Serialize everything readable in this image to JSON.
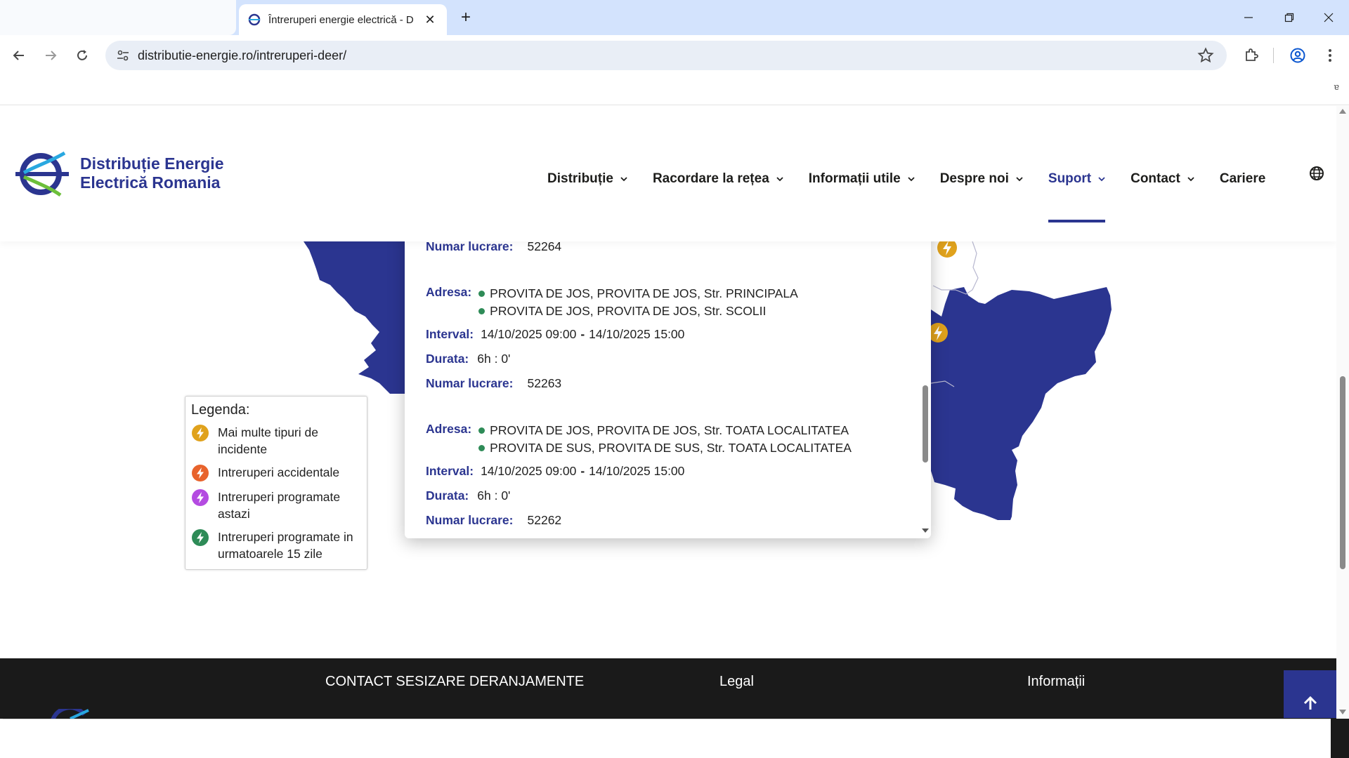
{
  "browser": {
    "tab_title": "Întreruperi energie electrică - D",
    "url": "distributie-energie.ro/intreruperi-deer/",
    "strip_glyph": "ɐ"
  },
  "site": {
    "logo_line1": "Distribuție Energie",
    "logo_line2": "Electrică Romania",
    "nav": [
      {
        "label": "Distribuție",
        "has_dropdown": true,
        "active": false
      },
      {
        "label": "Racordare la rețea",
        "has_dropdown": true,
        "active": false
      },
      {
        "label": "Informații utile",
        "has_dropdown": true,
        "active": false
      },
      {
        "label": "Despre noi",
        "has_dropdown": true,
        "active": false
      },
      {
        "label": "Suport",
        "has_dropdown": true,
        "active": true
      },
      {
        "label": "Contact",
        "has_dropdown": true,
        "active": false
      },
      {
        "label": "Cariere",
        "has_dropdown": false,
        "active": false
      }
    ],
    "colors": {
      "brand": "#2b3590",
      "map_fill": "#2b3590",
      "footer": "#1a1a1a"
    }
  },
  "popup": {
    "labels": {
      "address": "Adresa:",
      "interval": "Interval:",
      "duration": "Durata:",
      "work_no": "Numar lucrare:"
    },
    "top_work_no": "52264",
    "entries": [
      {
        "addresses": [
          "PROVITA DE JOS, PROVITA DE JOS, Str. PRINCIPALA",
          "PROVITA DE JOS, PROVITA DE JOS, Str. SCOLII"
        ],
        "interval_start": "14/10/2025 09:00",
        "interval_sep": "-",
        "interval_end": "14/10/2025 15:00",
        "duration": "6h : 0'",
        "work_no": "52263"
      },
      {
        "addresses": [
          "PROVITA DE JOS, PROVITA DE JOS, Str. TOATA LOCALITATEA",
          "PROVITA DE SUS, PROVITA DE SUS, Str. TOATA LOCALITATEA"
        ],
        "interval_start": "14/10/2025 09:00",
        "interval_sep": "-",
        "interval_end": "14/10/2025 15:00",
        "duration": "6h : 0'",
        "work_no": "52262"
      }
    ]
  },
  "legend": {
    "title": "Legenda:",
    "items": [
      {
        "label": "Mai multe tipuri de incidente",
        "color": "#e0a21c"
      },
      {
        "label": "Intreruperi accidentale",
        "color": "#e8632c"
      },
      {
        "label": "Intreruperi programate astazi",
        "color": "#b44be1"
      },
      {
        "label": "Intreruperi programate in urmatoarele 15 zile",
        "color": "#2e8b57"
      }
    ]
  },
  "footer": {
    "col1": "CONTACT SESIZARE DERANJAMENTE",
    "col2": "Legal",
    "col3": "Informații"
  }
}
